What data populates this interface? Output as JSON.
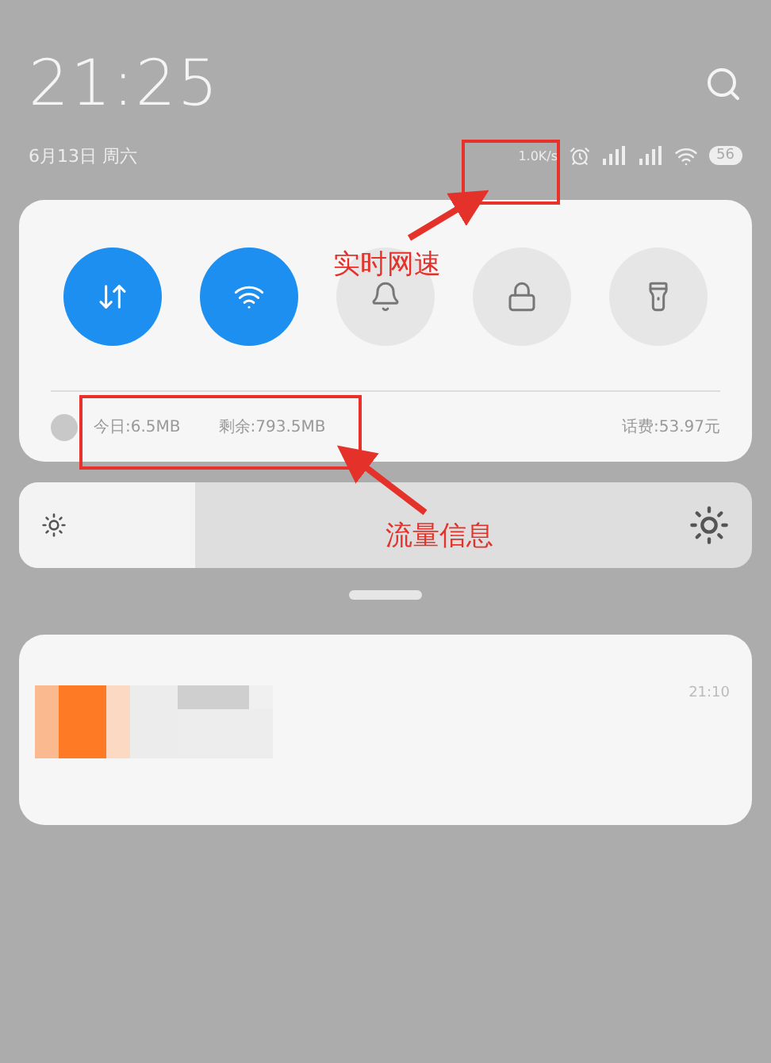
{
  "status_bar": {
    "time": "21:25",
    "date": "6月13日 周六",
    "network_speed": "1.0K/s",
    "battery": "56"
  },
  "toggles": [
    {
      "kind": "data",
      "on": true
    },
    {
      "kind": "wifi",
      "on": true
    },
    {
      "kind": "bell",
      "on": false
    },
    {
      "kind": "lock",
      "on": false
    },
    {
      "kind": "flashlight",
      "on": false
    }
  ],
  "data_usage": {
    "today": "今日:6.5MB",
    "remaining": "剩余:793.5MB",
    "balance": "话费:53.97元"
  },
  "brightness": {
    "level": 0.24
  },
  "notification": {
    "time": "21:10"
  },
  "annotations": [
    {
      "label": "实时网速"
    },
    {
      "label": "流量信息"
    }
  ]
}
